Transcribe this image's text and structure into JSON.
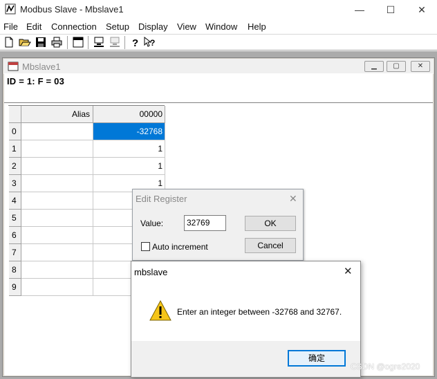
{
  "window": {
    "title": "Modbus Slave - Mbslave1",
    "minimize_glyph": "—",
    "maximize_glyph": "☐",
    "close_glyph": "✕"
  },
  "menu": [
    "File",
    "Edit",
    "Connection",
    "Setup",
    "Display",
    "View",
    "Window",
    "Help"
  ],
  "toolbar": {
    "icons": [
      "new-file-icon",
      "open-folder-icon",
      "save-icon",
      "print-icon",
      "window-icon",
      "connect-icon",
      "disconnect-icon",
      "help-icon",
      "context-help-icon"
    ]
  },
  "child": {
    "title": "Mbslave1",
    "header": "ID = 1: F = 03"
  },
  "grid": {
    "columns": [
      "Alias",
      "00000"
    ],
    "rows": [
      {
        "index": "0",
        "alias": "",
        "value": "-32768"
      },
      {
        "index": "1",
        "alias": "",
        "value": "1"
      },
      {
        "index": "2",
        "alias": "",
        "value": "1"
      },
      {
        "index": "3",
        "alias": "",
        "value": "1"
      },
      {
        "index": "4",
        "alias": "",
        "value": ""
      },
      {
        "index": "5",
        "alias": "",
        "value": ""
      },
      {
        "index": "6",
        "alias": "",
        "value": ""
      },
      {
        "index": "7",
        "alias": "",
        "value": ""
      },
      {
        "index": "8",
        "alias": "",
        "value": ""
      },
      {
        "index": "9",
        "alias": "",
        "value": ""
      }
    ]
  },
  "edit_dialog": {
    "title": "Edit Register",
    "value_label": "Value:",
    "value": "32769",
    "ok": "OK",
    "cancel": "Cancel",
    "auto_increment": "Auto increment"
  },
  "message_box": {
    "title": "mbslave",
    "text": "Enter an integer between -32768 and 32767.",
    "confirm": "确定"
  },
  "watermark": "CSDN @ogre2020",
  "colors": {
    "selection": "#0078d7",
    "warning": "#f5c518"
  }
}
